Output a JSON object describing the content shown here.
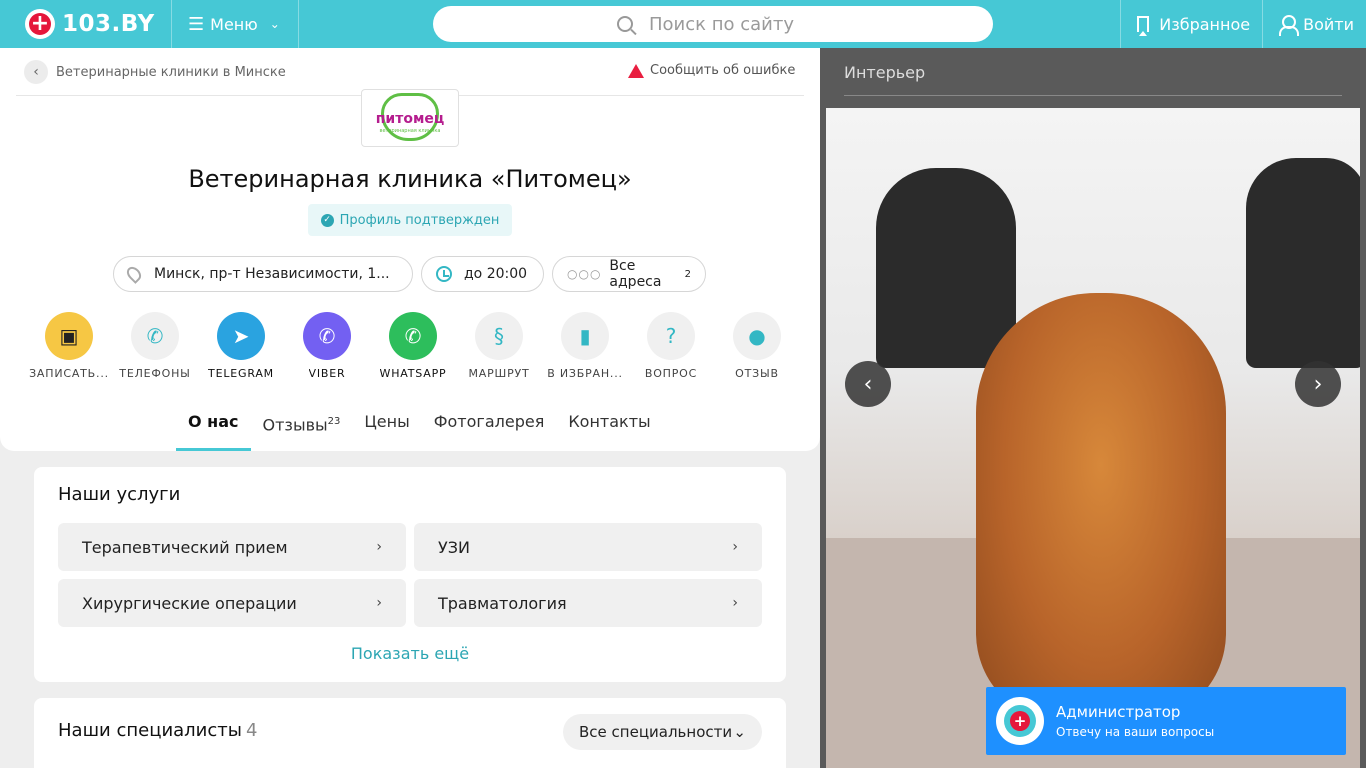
{
  "header": {
    "logo_text": "103.BY",
    "menu_label": "Меню",
    "search_placeholder": "Поиск по сайту",
    "favorites_label": "Избранное",
    "login_label": "Войти"
  },
  "breadcrumb": {
    "label": "Ветеринарные клиники в Минске"
  },
  "report_label": "Сообщить об ошибке",
  "clinic": {
    "logo_name": "питомец",
    "logo_sub": "ветеринарная клиника",
    "title": "Ветеринарная клиника «Питомец»",
    "verified_label": "Профиль подтвержден",
    "address": "Минск, пр-т Независимости, 1...",
    "hours": "до 20:00",
    "all_addresses": "Все адреса",
    "addresses_count": "2"
  },
  "actions": [
    {
      "label": "ЗАПИСАТЬ...",
      "icon": "calendar-icon",
      "color": "#f6c744"
    },
    {
      "label": "ТЕЛЕФОНЫ",
      "icon": "phone-icon",
      "color": "#f0f0f0"
    },
    {
      "label": "TELEGRAM",
      "icon": "telegram-icon",
      "color": "#2aa3e0"
    },
    {
      "label": "VIBER",
      "icon": "viber-icon",
      "color": "#7360f2"
    },
    {
      "label": "WHATSAPP",
      "icon": "whatsapp-icon",
      "color": "#2dbe5c"
    },
    {
      "label": "МАРШРУТ",
      "icon": "route-icon",
      "color": "#f0f0f0"
    },
    {
      "label": "В ИЗБРАН...",
      "icon": "bookmark-icon",
      "color": "#f0f0f0"
    },
    {
      "label": "ВОПРОС",
      "icon": "question-icon",
      "color": "#f0f0f0"
    },
    {
      "label": "ОТЗЫВ",
      "icon": "comment-icon",
      "color": "#f0f0f0"
    }
  ],
  "tabs": [
    {
      "label": "О нас",
      "active": true
    },
    {
      "label": "Отзывы",
      "badge": "23"
    },
    {
      "label": "Цены"
    },
    {
      "label": "Фотогалерея"
    },
    {
      "label": "Контакты"
    }
  ],
  "services": {
    "title": "Наши услуги",
    "items": [
      "Терапевтический прием",
      "УЗИ",
      "Хирургические операции",
      "Травматология"
    ],
    "show_more": "Показать ещё"
  },
  "specialists": {
    "title": "Наши специалисты",
    "count": "4",
    "filter_label": "Все специальности"
  },
  "gallery": {
    "title": "Интерьер"
  },
  "chat": {
    "title": "Администратор",
    "subtitle": "Отвечу на ваши вопросы"
  },
  "colors": {
    "brand": "#46c8d5",
    "accent_red": "#e5173b",
    "link": "#2ca6b3",
    "chat": "#1e90ff"
  }
}
